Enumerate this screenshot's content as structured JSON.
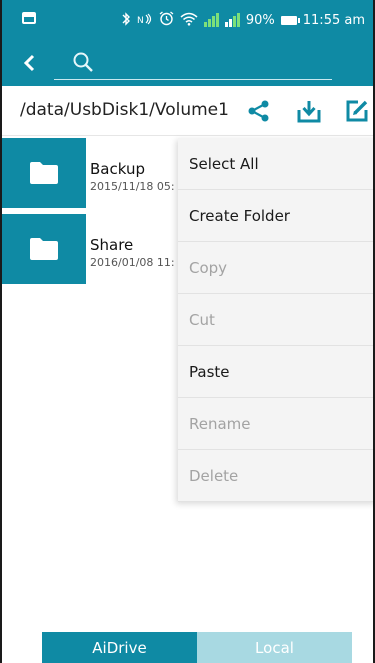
{
  "status_bar": {
    "battery": "90%",
    "time": "11:55 am",
    "icons": [
      "image-icon",
      "bluetooth-icon",
      "nfc-icon",
      "alarm-icon",
      "wifi-icon",
      "signal-icon",
      "battery-icon"
    ]
  },
  "app_bar": {
    "back_icon": "chevron-left-icon",
    "search_placeholder": "",
    "search_icon": "search-icon"
  },
  "path_bar": {
    "path": "/data/UsbDisk1/Volume1",
    "actions": [
      "share-icon",
      "download-icon",
      "edit-icon"
    ]
  },
  "files": [
    {
      "name": "Backup",
      "date": "2015/11/18 05:"
    },
    {
      "name": "Share",
      "date": "2016/01/08 11:"
    }
  ],
  "context_menu": {
    "items": [
      {
        "label": "Select All",
        "enabled": true
      },
      {
        "label": "Create Folder",
        "enabled": true
      },
      {
        "label": "Copy",
        "enabled": false
      },
      {
        "label": "Cut",
        "enabled": false
      },
      {
        "label": "Paste",
        "enabled": true
      },
      {
        "label": "Rename",
        "enabled": false
      },
      {
        "label": "Delete",
        "enabled": false
      }
    ]
  },
  "bottom_tabs": [
    {
      "label": "AiDrive",
      "active": true
    },
    {
      "label": "Local",
      "active": false
    }
  ],
  "colors": {
    "primary": "#0f8aa4",
    "tab_inactive": "#a8d9e2",
    "menu_bg": "#f4f4f4",
    "disabled_text": "#a3a3a3"
  }
}
